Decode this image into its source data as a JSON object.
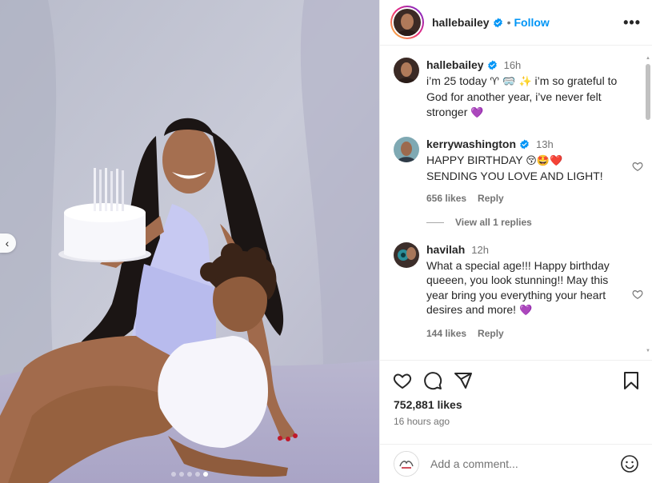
{
  "post": {
    "username": "hallebailey",
    "follow_label": "Follow",
    "more_label": "•••",
    "caption": {
      "username": "hallebailey",
      "time": "16h",
      "text_1": "i’m 25 today ",
      "emoji_1": "♈ 🥽 ✨",
      "text_2": " i’m so grateful to God for another year, i’ve never felt stronger ",
      "emoji_2": "💜"
    },
    "comments": [
      {
        "username": "kerrywashington",
        "time": "13h",
        "text_1": "HAPPY BIRTHDAY ",
        "emoji_1": "😚🤩❤️",
        "text_2": " SENDING YOU LOVE AND LIGHT!",
        "likes": "656 likes",
        "reply_label": "Reply",
        "view_replies": "View all 1 replies"
      },
      {
        "username": "havilah",
        "time": "12h",
        "text_1": "What a special age!!! Happy birthday queeen, you look stunning!! May this year bring you everything your heart desires and more! ",
        "emoji_1": "💜",
        "likes": "144 likes",
        "reply_label": "Reply"
      }
    ],
    "likes_count": "752,881 likes",
    "time_ago": "16 hours ago",
    "add_comment_placeholder": "Add a comment...",
    "carousel": {
      "slides": 5,
      "active_index": 4
    }
  },
  "colors": {
    "link_blue": "#0095f6",
    "verified_blue": "#0095f6",
    "muted": "#737373",
    "text": "#262626"
  }
}
